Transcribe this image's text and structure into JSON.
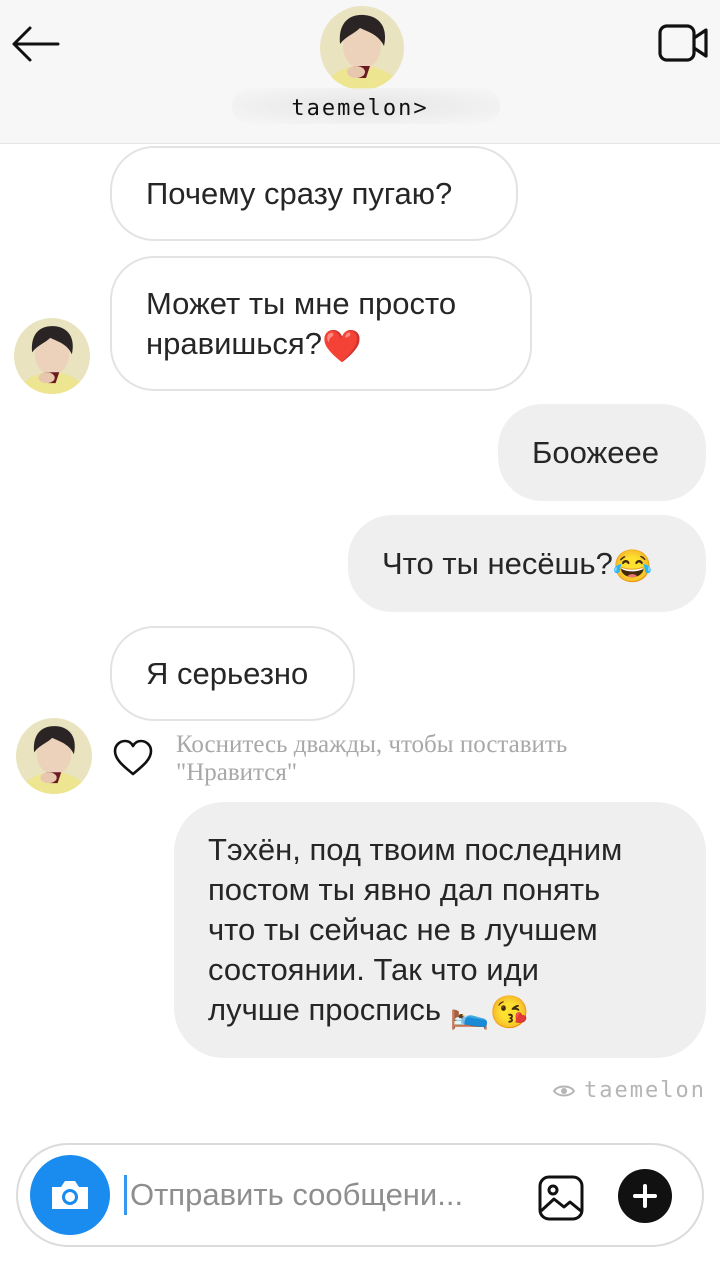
{
  "header": {
    "username": "taemelon>",
    "back_icon": "arrow-left-icon",
    "video_icon": "video-camera-icon"
  },
  "messages": [
    {
      "direction": "incoming",
      "text": "Почему сразу пугаю?"
    },
    {
      "direction": "incoming",
      "text": "Может ты мне просто",
      "text2": "нравишься?",
      "emoji": "❤️"
    },
    {
      "direction": "outgoing",
      "text": "Боожеее"
    },
    {
      "direction": "outgoing",
      "text": "Что ты несёшь?",
      "emoji": "😂"
    },
    {
      "direction": "incoming",
      "text": "Я серьезно"
    },
    {
      "direction": "outgoing",
      "lines": [
        "Тэхён, под твоим последним",
        "постом ты явно дал понять",
        "что ты сейчас не в лучшем",
        "состоянии. Так что иди",
        "лучше проспись"
      ],
      "emoji": "🛌😘"
    }
  ],
  "like_hint": {
    "line1": "Коснитесь дважды, чтобы поставить",
    "line2": "\"Нравится\""
  },
  "watermark": "taemelon",
  "composer": {
    "placeholder": "Отправить сообщени...",
    "camera_icon": "camera-icon",
    "gallery_icon": "image-icon",
    "plus_icon": "plus-icon"
  },
  "colors": {
    "accent": "#1a8cf0",
    "incoming_bubble_border": "#e3e3e3",
    "outgoing_bubble_bg": "#efefef",
    "hint_text": "#a8a8a8"
  }
}
